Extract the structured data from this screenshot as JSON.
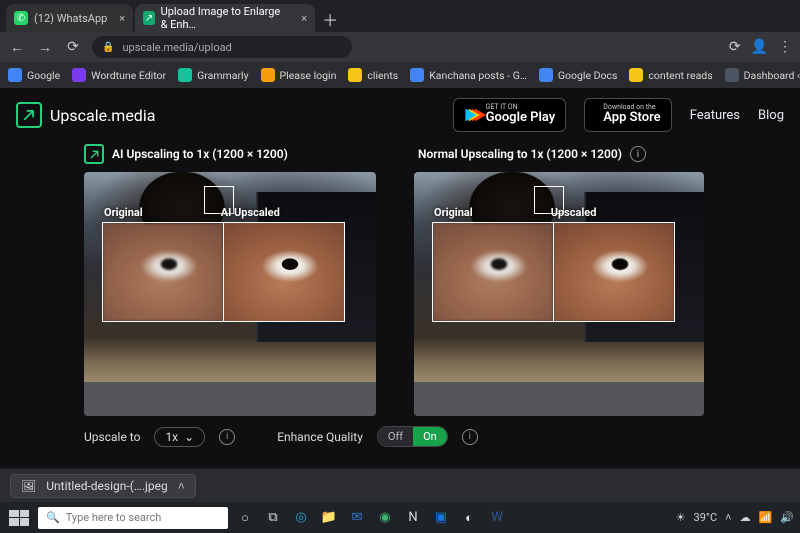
{
  "browser": {
    "tabs": [
      {
        "title": "(12) WhatsApp",
        "favicon": "whatsapp"
      },
      {
        "title": "Upload Image to Enlarge & Enh…",
        "favicon": "upscale"
      }
    ],
    "active_tab_index": 1,
    "url": "upscale.media/upload",
    "bookmarks": [
      {
        "label": "Google",
        "color": "#4285f4"
      },
      {
        "label": "Wordtune Editor",
        "color": "#7c3aed"
      },
      {
        "label": "Grammarly",
        "color": "#15c39a"
      },
      {
        "label": "Please login",
        "color": "#f59e0b"
      },
      {
        "label": "clients",
        "color": "#f5c518"
      },
      {
        "label": "Kanchana posts - G…",
        "color": "#4285f4"
      },
      {
        "label": "Google Docs",
        "color": "#4285f4"
      },
      {
        "label": "content reads",
        "color": "#f5c518"
      },
      {
        "label": "Dashboard ‹ — Wo…",
        "color": "#4b5563"
      }
    ]
  },
  "header": {
    "brand": "Upscale.media",
    "google_play": {
      "small": "GET IT ON",
      "big": "Google Play"
    },
    "app_store": {
      "small": "Download on the",
      "big": "App Store"
    },
    "links": {
      "features": "Features",
      "blog": "Blog"
    }
  },
  "compare": {
    "ai": {
      "title": "AI Upscaling to 1x (1200 × 1200)",
      "left_label": "Original",
      "right_label": "AI Upscaled"
    },
    "normal": {
      "title": "Normal Upscaling to 1x (1200 × 1200)",
      "left_label": "Original",
      "right_label": "Upscaled"
    }
  },
  "controls": {
    "upscale_label": "Upscale to",
    "upscale_value": "1x",
    "enhance_label": "Enhance Quality",
    "toggle_off": "Off",
    "toggle_on": "On"
  },
  "downloads": {
    "file": "Untitled-design-(….jpeg"
  },
  "taskbar": {
    "search_placeholder": "Type here to search",
    "weather": "39°C"
  }
}
